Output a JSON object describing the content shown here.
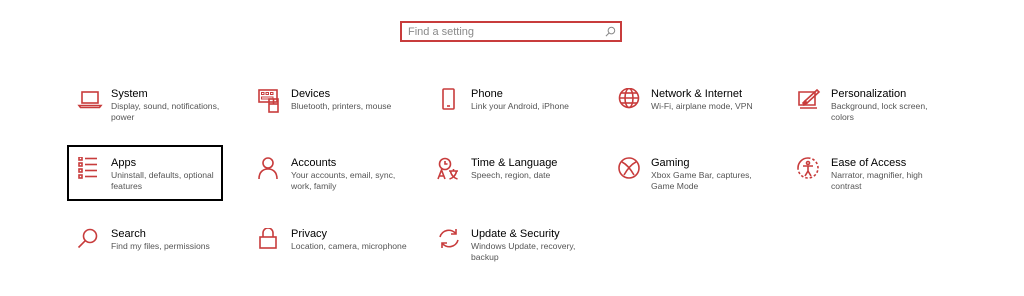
{
  "search": {
    "placeholder": "Find a setting",
    "value": ""
  },
  "accent_color": "#c83c3c",
  "tiles": [
    {
      "title": "System",
      "desc": "Display, sound, notifications, power",
      "icon": "laptop-icon"
    },
    {
      "title": "Devices",
      "desc": "Bluetooth, printers, mouse",
      "icon": "keyboard-icon"
    },
    {
      "title": "Phone",
      "desc": "Link your Android, iPhone",
      "icon": "phone-icon"
    },
    {
      "title": "Network & Internet",
      "desc": "Wi-Fi, airplane mode, VPN",
      "icon": "globe-icon"
    },
    {
      "title": "Personalization",
      "desc": "Background, lock screen, colors",
      "icon": "paintbrush-icon"
    },
    {
      "title": "Apps",
      "desc": "Uninstall, defaults, optional features",
      "icon": "apps-list-icon"
    },
    {
      "title": "Accounts",
      "desc": "Your accounts, email, sync, work, family",
      "icon": "person-icon"
    },
    {
      "title": "Time & Language",
      "desc": "Speech, region, date",
      "icon": "language-icon"
    },
    {
      "title": "Gaming",
      "desc": "Xbox Game Bar, captures, Game Mode",
      "icon": "xbox-icon"
    },
    {
      "title": "Ease of Access",
      "desc": "Narrator, magnifier, high contrast",
      "icon": "ease-of-access-icon"
    },
    {
      "title": "Search",
      "desc": "Find my files, permissions",
      "icon": "search-icon"
    },
    {
      "title": "Privacy",
      "desc": "Location, camera, microphone",
      "icon": "lock-icon"
    },
    {
      "title": "Update & Security",
      "desc": "Windows Update, recovery, backup",
      "icon": "sync-icon"
    }
  ]
}
